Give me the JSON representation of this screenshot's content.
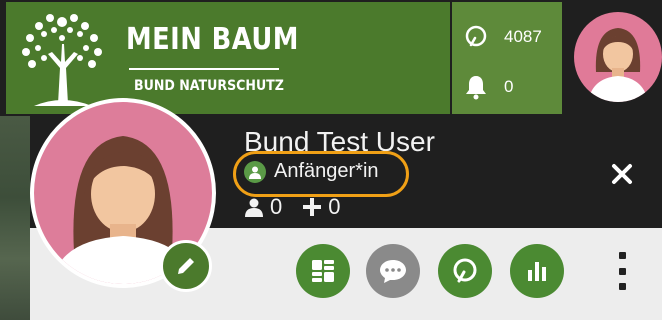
{
  "header": {
    "brand_title": "MEIN BAUM",
    "brand_subtitle": "BUND NATURSCHUTZ",
    "logo_icon": "tree-logo-icon",
    "stats": {
      "leaves": {
        "icon": "leaf-icon",
        "value": "4087"
      },
      "notifications": {
        "icon": "bell-icon",
        "value": "0"
      }
    }
  },
  "profile": {
    "username": "Bund Test User",
    "level_label": "Anfänger*in",
    "level_icon": "user-level-icon",
    "followers": {
      "icon": "person-icon",
      "value": "0"
    },
    "following": {
      "icon": "plus-icon",
      "value": "0"
    },
    "highlight_color": "#f0a016"
  },
  "actions": [
    {
      "name": "overview",
      "icon": "list-grid-icon"
    },
    {
      "name": "messages",
      "icon": "chat-icon"
    },
    {
      "name": "leaves",
      "icon": "leaf-icon"
    },
    {
      "name": "statistics",
      "icon": "bar-chart-icon"
    }
  ],
  "colors": {
    "brand_green": "#4b7a2c",
    "dark_bg": "#1f1f1f",
    "avatar_pink": "#e07a98",
    "highlight_orange": "#f0a016"
  }
}
